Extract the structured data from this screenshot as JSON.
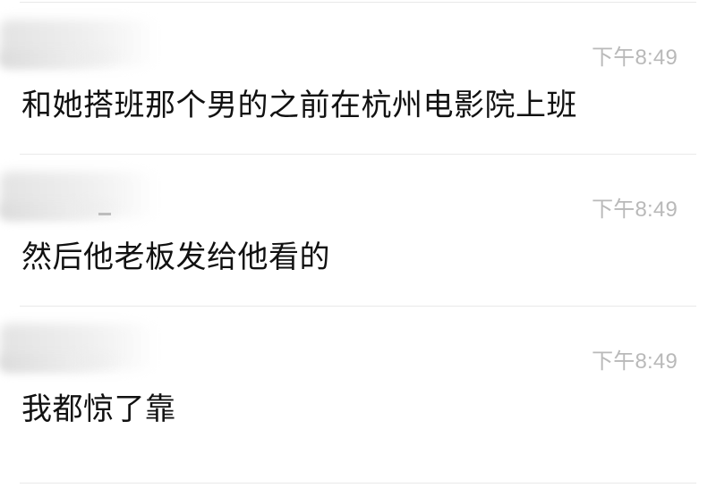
{
  "messages": [
    {
      "time": "下午8:49",
      "text": "和她搭班那个男的之前在杭州电影院上班"
    },
    {
      "time": "下午8:49",
      "text": "然后他老板发给他看的"
    },
    {
      "time": "下午8:49",
      "text": "我都惊了靠"
    }
  ]
}
